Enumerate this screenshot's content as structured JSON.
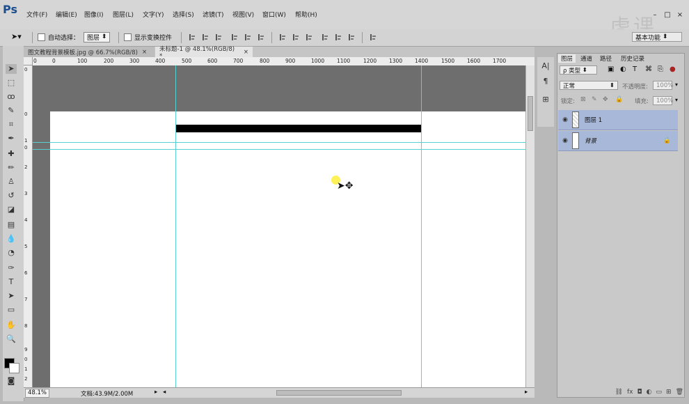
{
  "app": {
    "logo": "Ps",
    "workspace": "基本功能"
  },
  "menu": [
    "文件(F)",
    "编辑(E)",
    "图像(I)",
    "图层(L)",
    "文字(Y)",
    "选择(S)",
    "滤镜(T)",
    "视图(V)",
    "窗口(W)",
    "帮助(H)"
  ],
  "window_controls": {
    "minimize": "–",
    "restore": "□",
    "close": "×"
  },
  "watermark": "虎课",
  "options": {
    "auto_select_label": "自动选择：",
    "auto_select_value": "图层",
    "transform_controls_label": "显示变换控件"
  },
  "tabs": [
    {
      "label": "图文教程背景模板.jpg @ 66.7%(RGB/8)",
      "close": "×"
    },
    {
      "label": "未标题-1 @ 48.1%(RGB/8) *",
      "close": "×",
      "active": true
    }
  ],
  "ruler": {
    "h_labels": [
      "0",
      "0",
      "100",
      "200",
      "300",
      "400",
      "500",
      "600",
      "700",
      "800",
      "900",
      "1000",
      "1100",
      "1200",
      "1300",
      "1400",
      "1500",
      "1600",
      "1700"
    ],
    "v_labels": [
      "0",
      "0",
      "1",
      "0",
      "2",
      "3",
      "4",
      "5",
      "6",
      "7",
      "8",
      "9",
      "0",
      "1",
      "2"
    ]
  },
  "status": {
    "zoom": "48.1%",
    "doc_info": "文档:43.9M/2.00M"
  },
  "panel": {
    "tabs": [
      "图层",
      "通道",
      "路径",
      "历史记录"
    ],
    "filter_label": "ρ 类型",
    "blend_mode": "正常",
    "opacity_label": "不透明度:",
    "opacity_value": "100%",
    "lock_label": "锁定:",
    "fill_label": "填充:",
    "fill_value": "100%",
    "layers": [
      {
        "name": "图层 1",
        "selected": true
      },
      {
        "name": "背景",
        "locked": true
      }
    ]
  },
  "colors": {
    "guide": "#58cfd0",
    "layer_selected": "#a8b8d8",
    "pasteboard": "#6e6e6e"
  }
}
